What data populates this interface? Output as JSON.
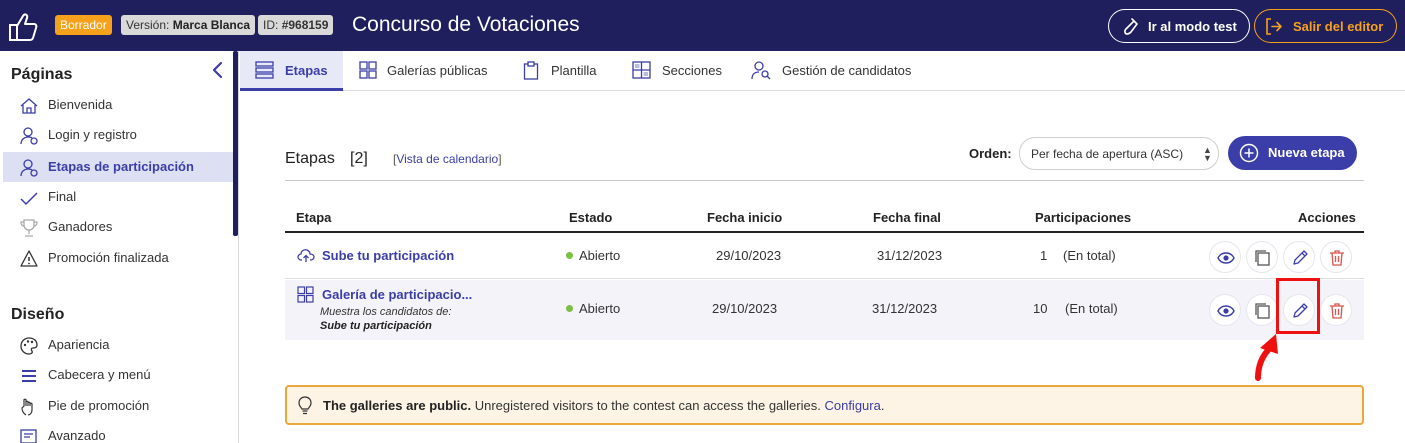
{
  "header": {
    "draft_badge": "Borrador",
    "version_label": "Versión:",
    "version_value": "Marca Blanca",
    "id_label": "ID:",
    "id_value": "#968159",
    "title": "Concurso de Votaciones",
    "test_mode_label": "Ir al modo test",
    "exit_label": "Salir del editor"
  },
  "sidebar": {
    "pages_title": "Páginas",
    "pages": [
      {
        "label": "Bienvenida",
        "icon": "home-icon"
      },
      {
        "label": "Login y registro",
        "icon": "user-icon"
      },
      {
        "label": "Etapas de participación",
        "icon": "user-gear-icon",
        "active": true
      },
      {
        "label": "Final",
        "icon": "check-icon"
      },
      {
        "label": "Ganadores",
        "icon": "trophy-icon"
      },
      {
        "label": "Promoción finalizada",
        "icon": "warning-icon"
      }
    ],
    "design_title": "Diseño",
    "design": [
      {
        "label": "Apariencia",
        "icon": "palette-icon"
      },
      {
        "label": "Cabecera y menú",
        "icon": "menu-icon"
      },
      {
        "label": "Pie de promoción",
        "icon": "hand-icon"
      },
      {
        "label": "Avanzado",
        "icon": "code-icon"
      }
    ]
  },
  "tabs": [
    {
      "label": "Etapas",
      "active": true
    },
    {
      "label": "Galerías públicas"
    },
    {
      "label": "Plantilla"
    },
    {
      "label": "Secciones"
    },
    {
      "label": "Gestión de candidatos"
    }
  ],
  "panel": {
    "title": "Etapas",
    "count": "[2]",
    "calendar_open": "[",
    "calendar_link": "Vista de calendario",
    "calendar_close": "]",
    "order_label": "Orden:",
    "order_value": "Per fecha de apertura (ASC)",
    "new_stage_label": "Nueva etapa"
  },
  "table": {
    "headers": [
      "Etapa",
      "Estado",
      "Fecha inicio",
      "Fecha final",
      "Participaciones",
      "Acciones"
    ],
    "rows": [
      {
        "name": "Sube tu participación",
        "status": "Abierto",
        "start": "29/10/2023",
        "end": "31/12/2023",
        "participations": "1",
        "participations_note": "(En total)"
      },
      {
        "name": "Galería de participacio...",
        "sub_label": "Muestra los candidatos de:",
        "sub_value": "Sube tu participación",
        "status": "Abierto",
        "start": "29/10/2023",
        "end": "31/12/2023",
        "participations": "10",
        "participations_note": "(En total)"
      }
    ]
  },
  "notice": {
    "bold": "The galleries are public.",
    "text": " Unregistered visitors to the contest can access the galleries. ",
    "link": "Configura",
    "end": "."
  },
  "colors": {
    "topbar": "#1f1f5e",
    "accent": "#3b3ea8",
    "draft": "#f5a11c",
    "status_open": "#7ac043",
    "delete": "#d9534f",
    "highlight": "#ee1111"
  }
}
